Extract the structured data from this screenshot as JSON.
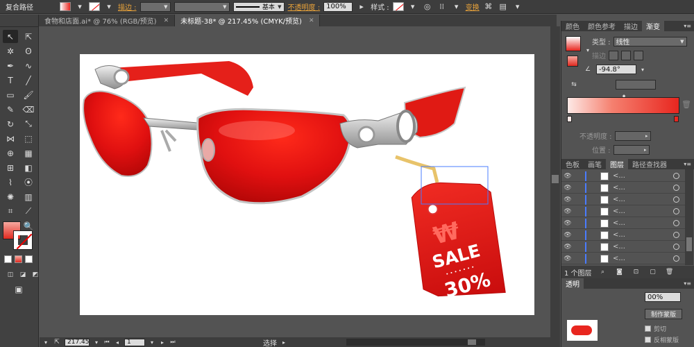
{
  "control_bar": {
    "object_type": "复合路径",
    "stroke_label": "描边 :",
    "stroke_style": "基本",
    "opacity_label": "不透明度 :",
    "opacity_value": "100%",
    "style_label": "样式 :",
    "transform_label": "变换"
  },
  "tabs": [
    {
      "label": "食物和店面.ai* @ 76% (RGB/预览)"
    },
    {
      "label": "未标题-38* @ 217.45% (CMYK/预览)"
    }
  ],
  "art": {
    "tag_symbol": "₩",
    "tag_sale": "SALE",
    "tag_dots": "• • • • • • •",
    "tag_percent": "30%"
  },
  "status_bar": {
    "zoom": "217.45",
    "page": "1",
    "tool_status": "选择"
  },
  "gradient_panel": {
    "tabs": [
      "颜色",
      "颜色参考",
      "描边",
      "渐变"
    ],
    "type_label": "类型 :",
    "type_value": "线性",
    "stroke_label": "描边",
    "angle_value": "-94.8°",
    "opacity_label": "不透明度 :",
    "location_label": "位置 :"
  },
  "layers_panel": {
    "tabs": [
      "色板",
      "画笔",
      "图层",
      "路径查找器"
    ],
    "rows": [
      {
        "name": "<..."
      },
      {
        "name": "<..."
      },
      {
        "name": "<..."
      },
      {
        "name": "<..."
      },
      {
        "name": "<..."
      },
      {
        "name": "<..."
      },
      {
        "name": "<..."
      },
      {
        "name": "<..."
      }
    ],
    "footer_count": "1 个图层"
  },
  "transparency_panel": {
    "tab_label": "透明",
    "opacity_value": "00%",
    "mask_button": "制作蒙版",
    "clip_label": "剪切",
    "invert_label": "反相蒙版"
  },
  "colors": {
    "accent_red": "#e8261f",
    "selection_blue": "#4a7cff",
    "ui_dark": "#3d3d3d",
    "ui_mid": "#535353"
  }
}
